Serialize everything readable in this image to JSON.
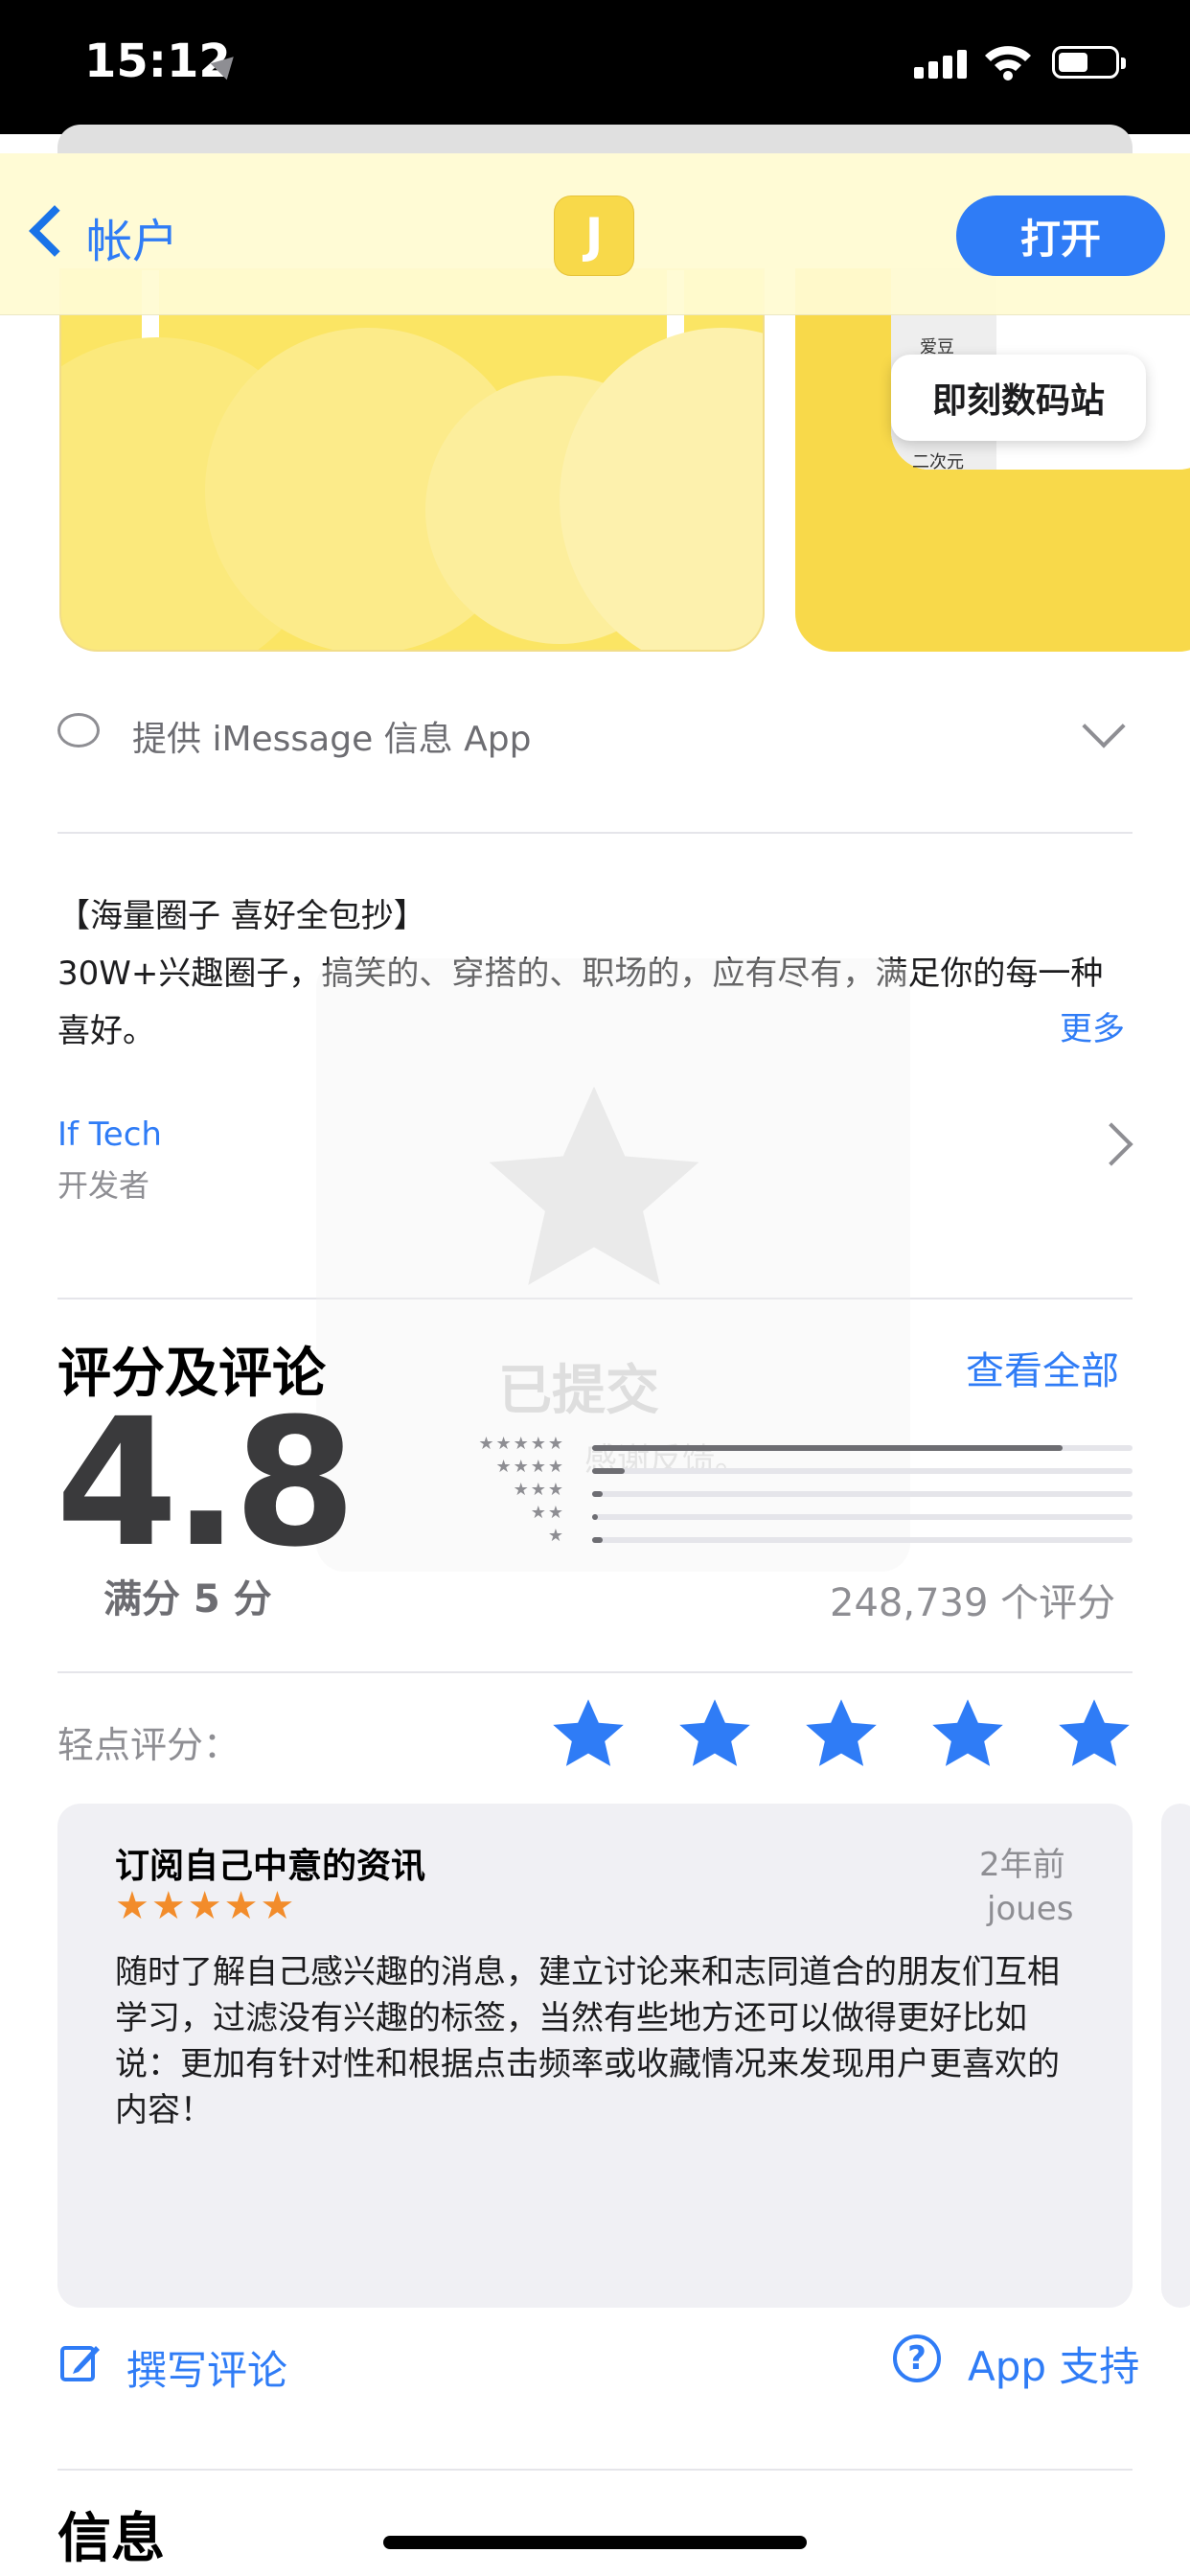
{
  "status_bar": {
    "time": "15:12"
  },
  "nav": {
    "back_label": "帐户",
    "app_icon_letter": "J",
    "open_label": "打开"
  },
  "screenshots": {
    "bubble_text": "即刻数码站",
    "mini_labels": [
      "爱豆",
      "二次元"
    ]
  },
  "imessage": {
    "label": "提供 iMessage 信息 App"
  },
  "description": {
    "title": "【海量圈子 喜好全包抄】",
    "body": "30W+兴趣圈子，搞笑的、穿搭的、职场的，应有尽有，满足你的每一种喜好。",
    "more": "更多"
  },
  "developer": {
    "name": "If Tech",
    "role": "开发者"
  },
  "overlay": {
    "text": "已提交",
    "sub": "感谢反馈。"
  },
  "ratings": {
    "title": "评分及评论",
    "see_all": "查看全部",
    "score": "4.8",
    "out_of": "满分 5 分",
    "count": "248,739 个评分",
    "histogram": [
      {
        "stars": "★★★★★",
        "fraction": 0.87
      },
      {
        "stars": "★★★★",
        "fraction": 0.06
      },
      {
        "stars": "★★★",
        "fraction": 0.02
      },
      {
        "stars": "★★",
        "fraction": 0.01
      },
      {
        "stars": "★",
        "fraction": 0.02
      }
    ]
  },
  "tap_to_rate": {
    "label": "轻点评分：",
    "stars": 5
  },
  "review": {
    "title": "订阅自己中意的资讯",
    "stars": "★★★★★",
    "date": "2年前",
    "author": "joues",
    "body": "随时了解自己感兴趣的消息，建立讨论来和志同道合的朋友们互相学习，过滤没有兴趣的标签，当然有些地方还可以做得更好比如说：更加有针对性和根据点击频率或收藏情况来发现用户更喜欢的内容！"
  },
  "actions": {
    "write_review": "撰写评论",
    "support": "App 支持",
    "support_icon": "?"
  },
  "info": {
    "title": "信息"
  },
  "colors": {
    "accent": "#2f7cf6",
    "brand_yellow": "#f8d94a",
    "review_star": "#f28c2b"
  }
}
